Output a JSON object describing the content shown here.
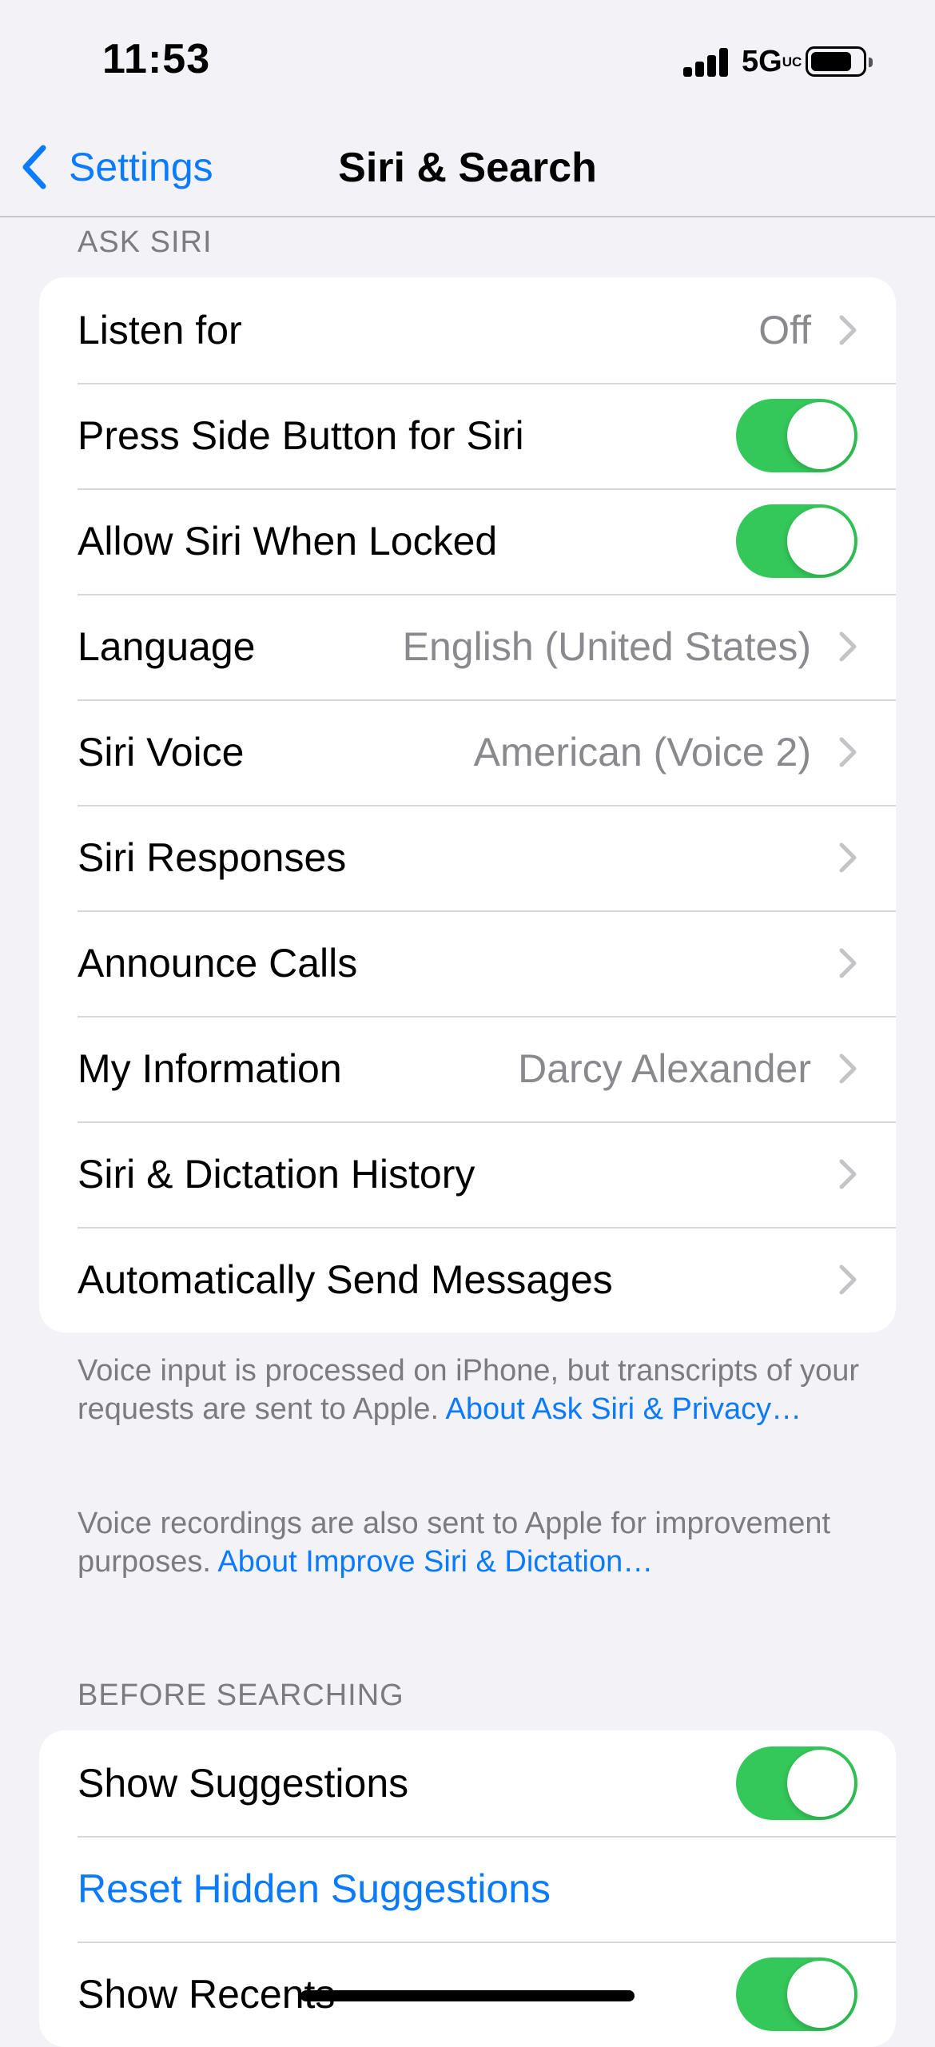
{
  "status_bar": {
    "time": "11:53",
    "network": "5G",
    "network_badge": "UC",
    "icons": [
      "cellular-signal-icon",
      "battery-icon"
    ]
  },
  "nav": {
    "back_label": "Settings",
    "title": "Siri & Search",
    "back_icon": "chevron-left-icon"
  },
  "ask_siri": {
    "header": "ASK SIRI",
    "rows": [
      {
        "label": "Listen for",
        "value": "Off"
      },
      {
        "label": "Press Side Button for Siri",
        "toggle": true
      },
      {
        "label": "Allow Siri When Locked",
        "toggle": true
      },
      {
        "label": "Language",
        "value": "English (United States)"
      },
      {
        "label": "Siri Voice",
        "value": "American (Voice 2)"
      },
      {
        "label": "Siri Responses"
      },
      {
        "label": "Announce Calls"
      },
      {
        "label": "My Information",
        "value": "Darcy Alexander"
      },
      {
        "label": "Siri & Dictation History"
      },
      {
        "label": "Automatically Send Messages"
      }
    ],
    "footer1_text": "Voice input is processed on iPhone, but transcripts of your requests are sent to Apple. ",
    "footer1_link": "About Ask Siri & Privacy…",
    "footer2_text": "Voice recordings are also sent to Apple for improvement purposes. ",
    "footer2_link": "About Improve Siri & Dictation…"
  },
  "before_searching": {
    "header": "BEFORE SEARCHING",
    "rows": [
      {
        "label": "Show Suggestions",
        "toggle": true
      },
      {
        "label": "Reset Hidden Suggestions"
      },
      {
        "label": "Show Recents",
        "toggle": true
      }
    ]
  },
  "colors": {
    "accent": "#0a7aff",
    "toggle_on": "#34c759",
    "background": "#f2f2f7",
    "secondary_text": "#8a8a8e"
  }
}
